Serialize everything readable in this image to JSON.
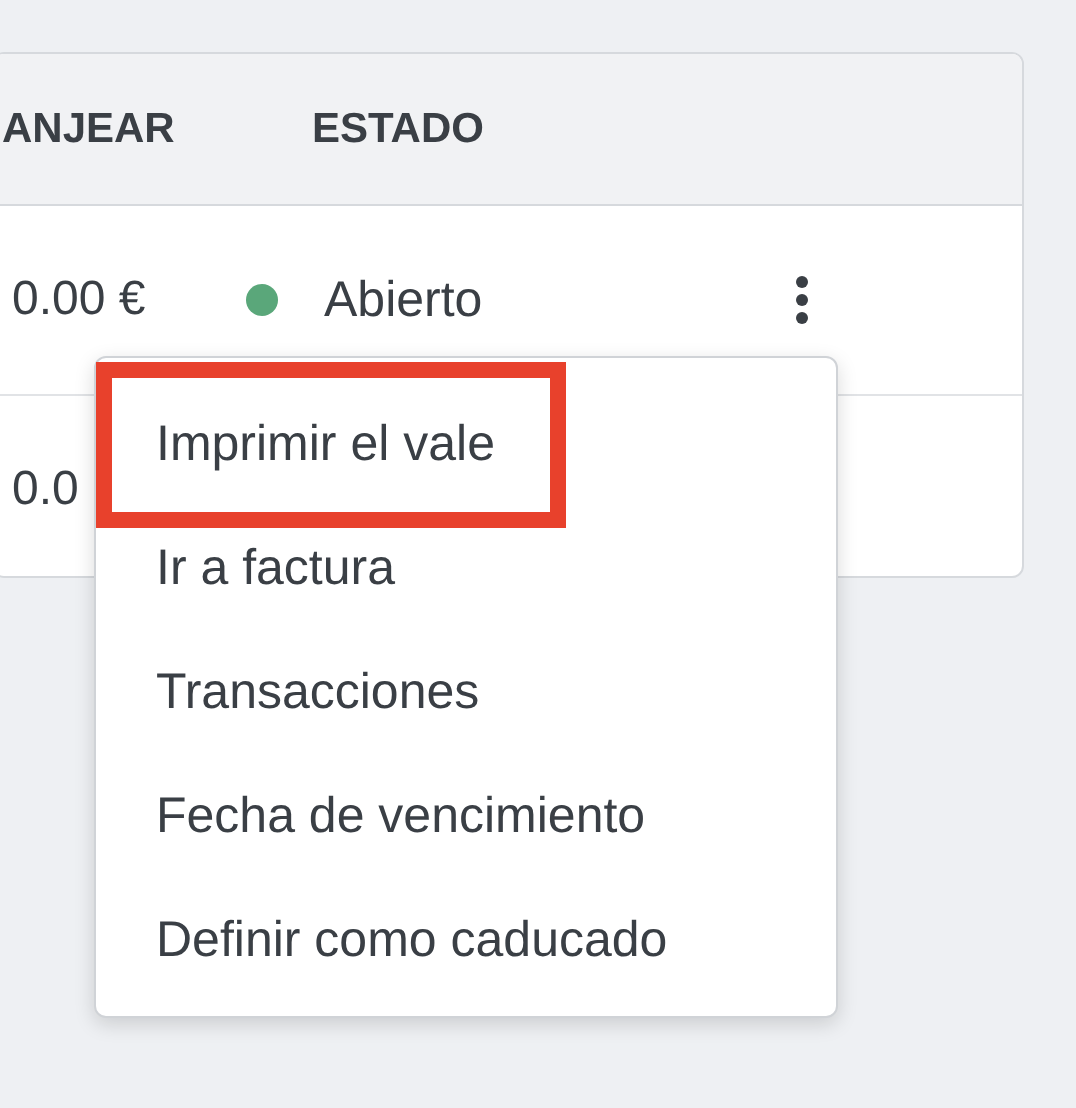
{
  "table": {
    "columns": [
      "ANJEAR",
      "ESTADO"
    ],
    "rows": [
      {
        "amount": "0.00 €",
        "status": "Abierto",
        "color": "#5aa77a"
      },
      {
        "amount": "0.0"
      }
    ]
  },
  "menu": {
    "items": [
      {
        "label": "Imprimir el vale",
        "highlighted": true
      },
      {
        "label": "Ir a factura",
        "highlighted": false
      },
      {
        "label": "Transacciones",
        "highlighted": false
      },
      {
        "label": "Fecha de vencimiento",
        "highlighted": false
      },
      {
        "label": "Definir como caducado",
        "highlighted": false
      }
    ]
  }
}
